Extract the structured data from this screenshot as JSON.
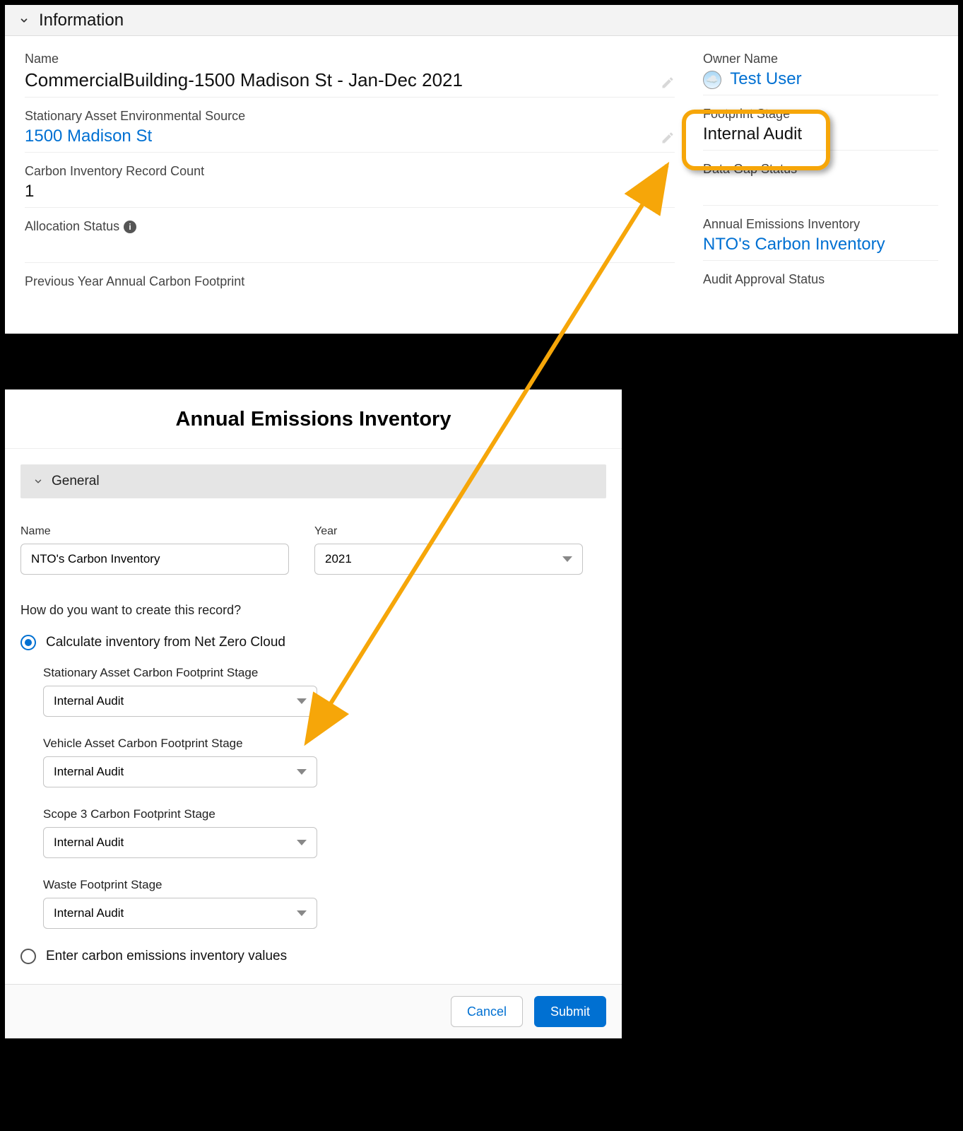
{
  "top": {
    "section_title": "Information",
    "left": {
      "name_label": "Name",
      "name_value": "CommercialBuilding-1500 Madison St - Jan-Dec 2021",
      "saes_label": "Stationary Asset Environmental Source",
      "saes_value": "1500 Madison St",
      "circ_label": "Carbon Inventory Record Count",
      "circ_value": "1",
      "alloc_label": "Allocation Status",
      "prev_label": "Previous Year Annual Carbon Footprint"
    },
    "right": {
      "owner_label": "Owner Name",
      "owner_value": "Test User",
      "stage_label": "Footprint Stage",
      "stage_value": "Internal Audit",
      "gap_label": "Data Gap Status",
      "aei_label": "Annual Emissions Inventory",
      "aei_value": "NTO's Carbon Inventory",
      "audit_label": "Audit Approval Status"
    }
  },
  "modal": {
    "title": "Annual Emissions Inventory",
    "general_label": "General",
    "name_label": "Name",
    "name_value": "NTO's Carbon Inventory",
    "year_label": "Year",
    "year_value": "2021",
    "question": "How do you want to create this record?",
    "radio_calc": "Calculate inventory from Net Zero Cloud",
    "radio_manual": "Enter carbon emissions inventory values",
    "stationary_label": "Stationary Asset Carbon Footprint Stage",
    "stationary_value": "Internal Audit",
    "vehicle_label": "Vehicle Asset Carbon Footprint Stage",
    "vehicle_value": "Internal Audit",
    "scope3_label": "Scope 3 Carbon Footprint Stage",
    "scope3_value": "Internal Audit",
    "waste_label": "Waste Footprint Stage",
    "waste_value": "Internal Audit",
    "cancel": "Cancel",
    "submit": "Submit"
  }
}
